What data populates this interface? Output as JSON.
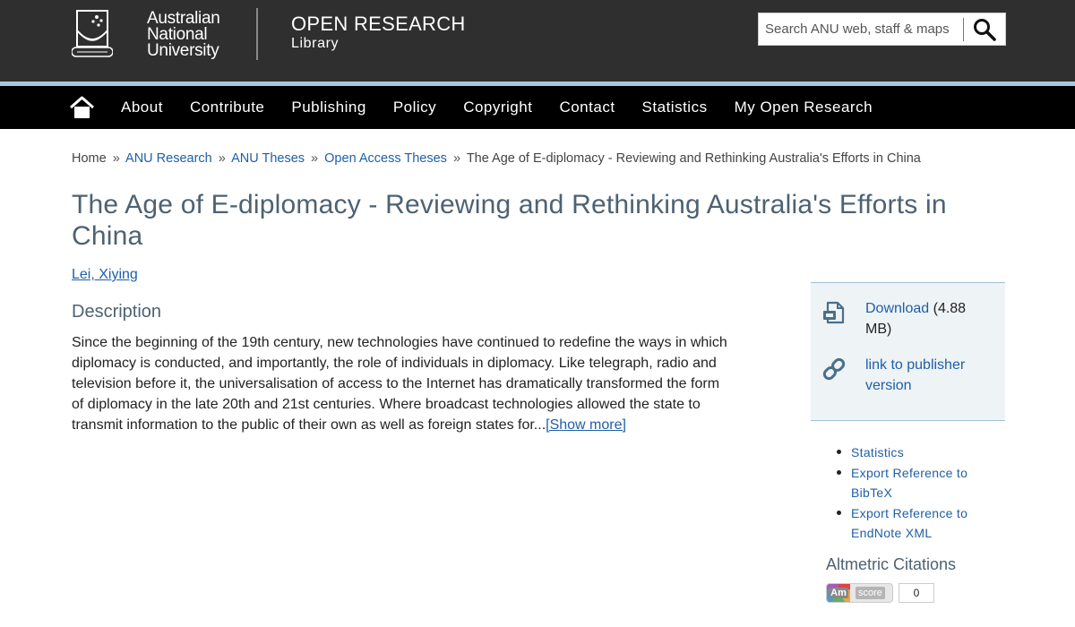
{
  "header": {
    "university_lines": [
      "Australian",
      "National",
      "University"
    ],
    "site_title": "OPEN RESEARCH",
    "site_subtitle": "Library",
    "search_placeholder": "Search ANU web, staff & maps"
  },
  "nav": {
    "items": [
      "About",
      "Contribute",
      "Publishing",
      "Policy",
      "Copyright",
      "Contact",
      "Statistics",
      "My Open Research"
    ]
  },
  "breadcrumb": {
    "links": [
      "Home",
      "ANU Research",
      "ANU Theses",
      "Open Access Theses"
    ],
    "separator": "»",
    "current": "The Age of E-diplomacy - Reviewing and Rethinking Australia's Efforts in China"
  },
  "title": "The Age of E-diplomacy - Reviewing and Rethinking Australia's Efforts in China",
  "author": "Lei, Xiying",
  "description": {
    "heading": "Description",
    "text": "Since the beginning of the 19th century, new technologies have continued to redefine the ways in which diplomacy is conducted, and importantly, the role of individuals in diplomacy. Like telegraph, radio and television before it, the universalisation of access to the Internet has dramatically transformed the form of diplomacy in the late 20th and 21st centuries. Where broadcast technologies allowed the state to transmit information to the public of their own as well as foreign states for...",
    "show_more": "[Show more]"
  },
  "sidebar": {
    "download_label": "Download",
    "download_size": "(4.88 MB)",
    "publisher_link": "link to publisher version",
    "list": [
      "Statistics",
      "Export Reference to BibTeX",
      "Export Reference to EndNote XML"
    ],
    "altmetric_heading": "Altmetric Citations",
    "altmetric_logo": "Am",
    "altmetric_score_label": "score",
    "altmetric_count": "0"
  },
  "colors": {
    "header_bg": "#2f2f2f",
    "accent_bar": "#a9c8dc",
    "nav_bg": "#000000",
    "link": "#1f5fa8",
    "heading": "#4d6273",
    "sidebar_bg": "#eef3f6"
  }
}
